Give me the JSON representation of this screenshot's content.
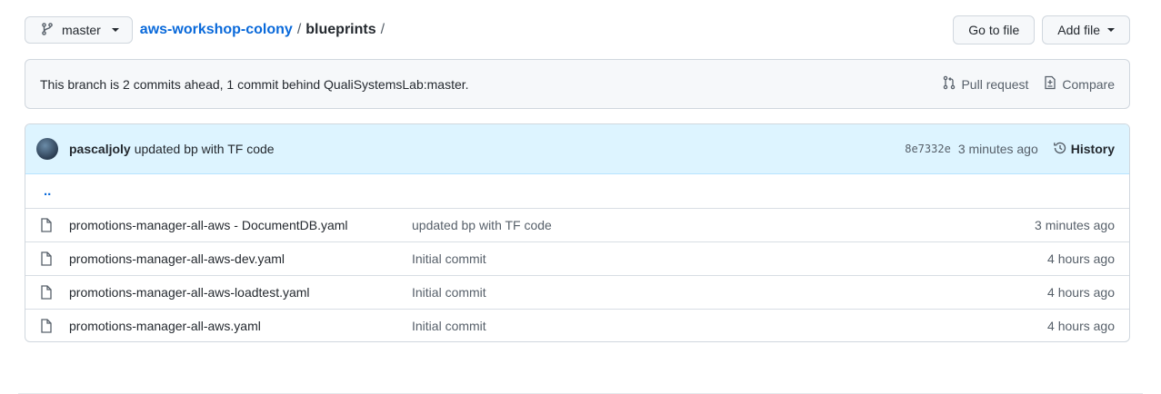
{
  "branch": {
    "name": "master"
  },
  "breadcrumb": {
    "repo": "aws-workshop-colony",
    "sep1": "/",
    "folder": "blueprints",
    "sep2": "/"
  },
  "actions": {
    "go_to_file": "Go to file",
    "add_file": "Add file"
  },
  "branch_info": {
    "text": "This branch is 2 commits ahead, 1 commit behind QualiSystemsLab:master.",
    "pull_request": "Pull request",
    "compare": "Compare"
  },
  "commit": {
    "author": "pascaljoly",
    "message": "updated bp with TF code",
    "sha": "8e7332e",
    "age": "3 minutes ago",
    "history_label": "History"
  },
  "updir": "..",
  "files": [
    {
      "name": "promotions-manager-all-aws - DocumentDB.yaml",
      "message": "updated bp with TF code",
      "age": "3 minutes ago"
    },
    {
      "name": "promotions-manager-all-aws-dev.yaml",
      "message": "Initial commit",
      "age": "4 hours ago"
    },
    {
      "name": "promotions-manager-all-aws-loadtest.yaml",
      "message": "Initial commit",
      "age": "4 hours ago"
    },
    {
      "name": "promotions-manager-all-aws.yaml",
      "message": "Initial commit",
      "age": "4 hours ago"
    }
  ]
}
